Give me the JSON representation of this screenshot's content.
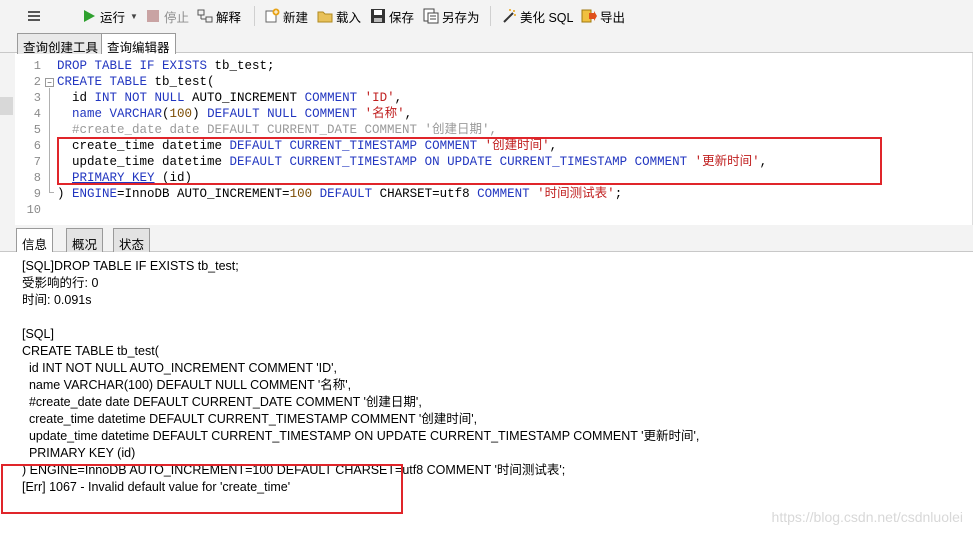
{
  "toolbar": {
    "run_label": "运行",
    "stop_label": "停止",
    "explain_label": "解释",
    "new_label": "新建",
    "load_label": "载入",
    "save_label": "保存",
    "save_as_label": "另存为",
    "beautify_label": "美化 SQL",
    "export_label": "导出"
  },
  "editor_tabs": [
    "查询创建工具",
    "查询编辑器"
  ],
  "code": {
    "line_numbers": [
      "1",
      "2",
      "3",
      "4",
      "5",
      "6",
      "7",
      "8",
      "9",
      "10"
    ],
    "l1": [
      "DROP TABLE IF EXISTS",
      " tb_test;"
    ],
    "l2": [
      "CREATE TABLE",
      " tb_test("
    ],
    "l3": [
      "  id ",
      "INT NOT NULL",
      " AUTO_INCREMENT ",
      "COMMENT",
      " ",
      "'ID'",
      ","
    ],
    "l4": [
      "  name ",
      "VARCHAR",
      "(",
      "100",
      ") ",
      "DEFAULT NULL COMMENT",
      " ",
      "'名称'",
      ","
    ],
    "l5": [
      "  #create_date date DEFAULT CURRENT_DATE COMMENT '创建日期',"
    ],
    "l6": [
      "  create_time datetime ",
      "DEFAULT CURRENT_TIMESTAMP COMMENT",
      " ",
      "'创建时间'",
      ","
    ],
    "l7": [
      "  update_time datetime ",
      "DEFAULT CURRENT_TIMESTAMP ON UPDATE CURRENT_TIMESTAMP COMMENT",
      " ",
      "'更新时间'",
      ","
    ],
    "l8": [
      "  ",
      "PRIMARY KEY",
      " (id)"
    ],
    "l9": [
      ") ",
      "ENGINE",
      "=InnoDB AUTO_INCREMENT=",
      "100",
      " ",
      "DEFAULT",
      " CHARSET=utf8 ",
      "COMMENT",
      " ",
      "'时间测试表'",
      ";"
    ]
  },
  "result_tabs": [
    "信息",
    "概况",
    "状态"
  ],
  "messages": [
    "[SQL]DROP TABLE IF EXISTS tb_test;",
    "受影响的行: 0",
    "时间: 0.091s",
    "",
    "[SQL]",
    "CREATE TABLE tb_test(",
    "  id INT NOT NULL AUTO_INCREMENT COMMENT 'ID',",
    "  name VARCHAR(100) DEFAULT NULL COMMENT '名称',",
    "  #create_date date DEFAULT CURRENT_DATE COMMENT '创建日期',",
    "  create_time datetime DEFAULT CURRENT_TIMESTAMP COMMENT '创建时间',",
    "  update_time datetime DEFAULT CURRENT_TIMESTAMP ON UPDATE CURRENT_TIMESTAMP COMMENT '更新时间',",
    "  PRIMARY KEY (id)",
    ") ENGINE=InnoDB AUTO_INCREMENT=100 DEFAULT CHARSET=utf8 COMMENT '时间测试表';",
    "[Err] 1067 - Invalid default value for 'create_time'"
  ],
  "watermark": "https://blog.csdn.net/csdnluolei",
  "colors": {
    "highlight_box": "#e0252a",
    "keyword": "#2236c0",
    "string": "#c02020"
  }
}
